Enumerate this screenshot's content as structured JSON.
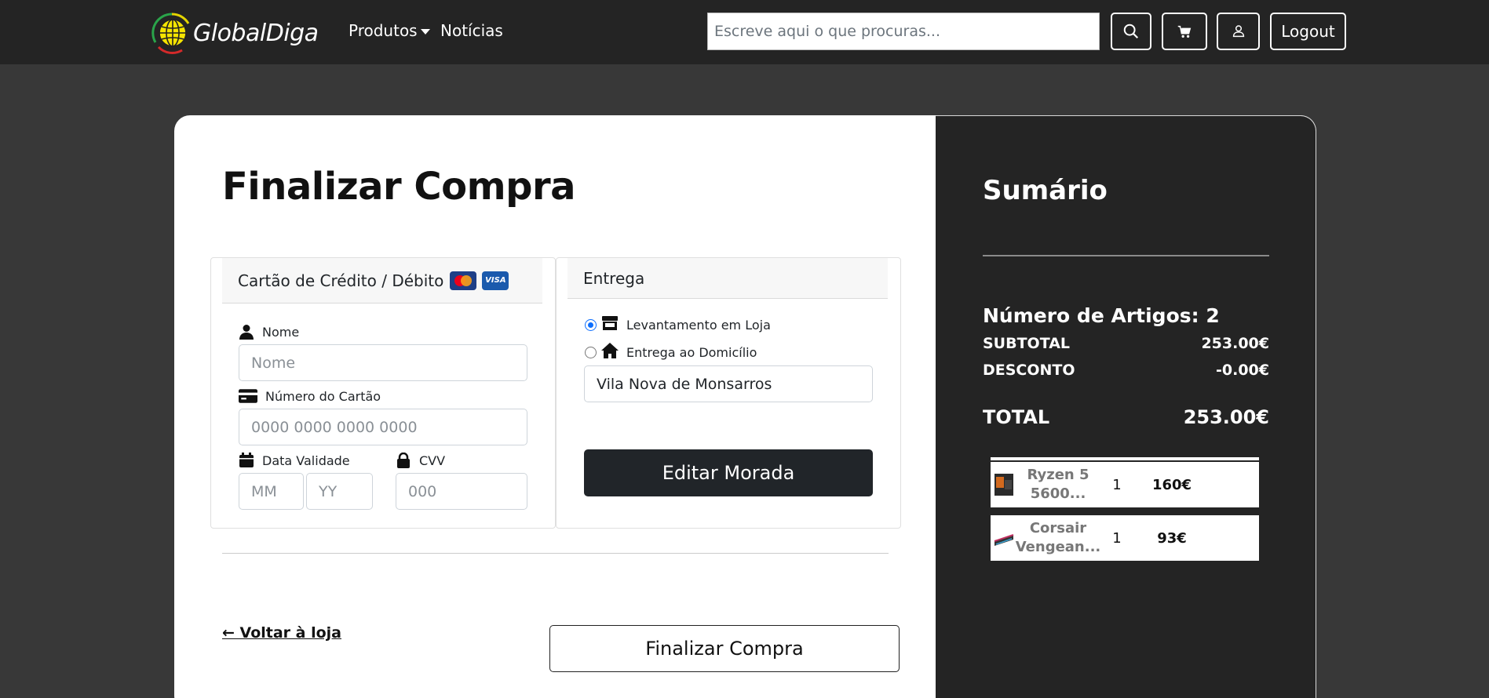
{
  "nav": {
    "logo_text": "GlobalDiga",
    "produtos": "Produtos",
    "noticias": "Notícias",
    "search_placeholder": "Escreve aqui o que procuras...",
    "logout": "Logout"
  },
  "checkout": {
    "title": "Finalizar Compra",
    "payment": {
      "header": "Cartão de Crédito / Débito",
      "visa_text": "VISA",
      "name_label": "Nome",
      "name_placeholder": "Nome",
      "card_label": "Número do Cartão",
      "card_placeholder": "0000 0000 0000 0000",
      "expiry_label": "Data Validade",
      "month_placeholder": "MM",
      "year_placeholder": "YY",
      "cvv_label": "CVV",
      "cvv_placeholder": "000"
    },
    "shipping": {
      "header": "Entrega",
      "option_store": "Levantamento em Loja",
      "option_home": "Entrega ao Domicílio",
      "address_value": "Vila Nova de Monsarros",
      "edit_button": "Editar Morada"
    },
    "back_link": "← Voltar à loja",
    "finish_button": "Finalizar Compra"
  },
  "summary": {
    "title": "Sumário",
    "item_count": "Número de Artigos: 2",
    "subtotal_label": "SUBTOTAL",
    "subtotal_value": "253.00€",
    "discount_label": "DESCONTO",
    "discount_value": "-0.00€",
    "total_label": "TOTAL",
    "total_value": "253.00€",
    "items": [
      {
        "name": "Ryzen 5 5600...",
        "qty": "1",
        "price": "160€"
      },
      {
        "name": "Corsair Vengean...",
        "qty": "1",
        "price": "93€"
      }
    ]
  }
}
